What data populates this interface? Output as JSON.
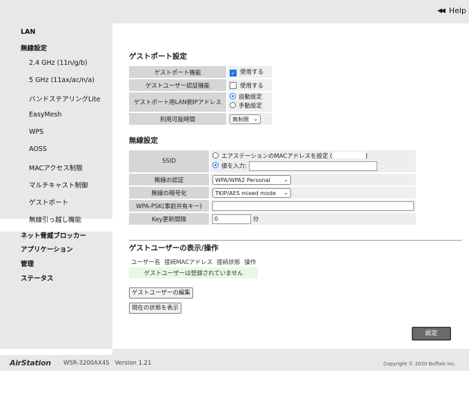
{
  "header": {
    "help_label": "Help"
  },
  "sidebar": {
    "items": [
      {
        "label": "LAN"
      },
      {
        "label": "無線設定"
      },
      {
        "label": "2.4 GHz (11n/g/b)"
      },
      {
        "label": "5 GHz (11ax/ac/n/a)"
      },
      {
        "label": "バンドステアリングLite"
      },
      {
        "label": "EasyMesh"
      },
      {
        "label": "WPS"
      },
      {
        "label": "AOSS"
      },
      {
        "label": "MACアクセス制限"
      },
      {
        "label": "マルチキャスト制御"
      },
      {
        "label": "ゲストポート"
      },
      {
        "label": "無線引っ越し機能"
      },
      {
        "label": "ネット脅威ブロッカー"
      },
      {
        "label": "アプリケーション"
      },
      {
        "label": "管理"
      },
      {
        "label": "ステータス"
      }
    ]
  },
  "guest_port": {
    "title": "ゲストポート設定",
    "function_label": "ゲストポート機能",
    "function_checkbox": "使用する",
    "function_checked": true,
    "auth_label": "ゲストユーザー認証機能",
    "auth_checkbox": "使用する",
    "auth_checked": false,
    "lan_ip_label": "ゲストポート用LAN側IPアドレス",
    "lan_ip_auto": "自動設定",
    "lan_ip_manual": "手動設定",
    "time_label": "利用可能時間",
    "time_value": "無制限"
  },
  "wireless": {
    "title": "無線設定",
    "ssid_label": "SSID",
    "ssid_opt_mac_prefix": "エアステーションのMACアドレスを設定 (",
    "ssid_opt_mac_suffix": ")",
    "ssid_opt_input": "値を入力:",
    "ssid_value": "",
    "auth_label": "無線の認証",
    "auth_value": "WPA/WPA2 Personal",
    "enc_label": "無線の暗号化",
    "enc_value": "TKIP/AES mixed mode",
    "psk_label": "WPA-PSK(事前共有キー)",
    "psk_value": "",
    "key_interval_label": "Key更新間隔",
    "key_interval_value": "0",
    "key_interval_unit": "分"
  },
  "guest_users": {
    "title": "ゲストユーザーの表示/操作",
    "columns": [
      "ユーザー名",
      "接続MACアドレス",
      "接続状態",
      "操作"
    ],
    "empty_message": "ゲストユーザーは登録されていません",
    "edit_button": "ゲストユーザーの編集",
    "status_button": "現在の状態を表示"
  },
  "submit_label": "設定",
  "footer": {
    "logo": "AirStation",
    "model": "WSR-3200AX4S   Version 1.21",
    "copyright": "Copyright © 2020 Buffalo Inc."
  }
}
